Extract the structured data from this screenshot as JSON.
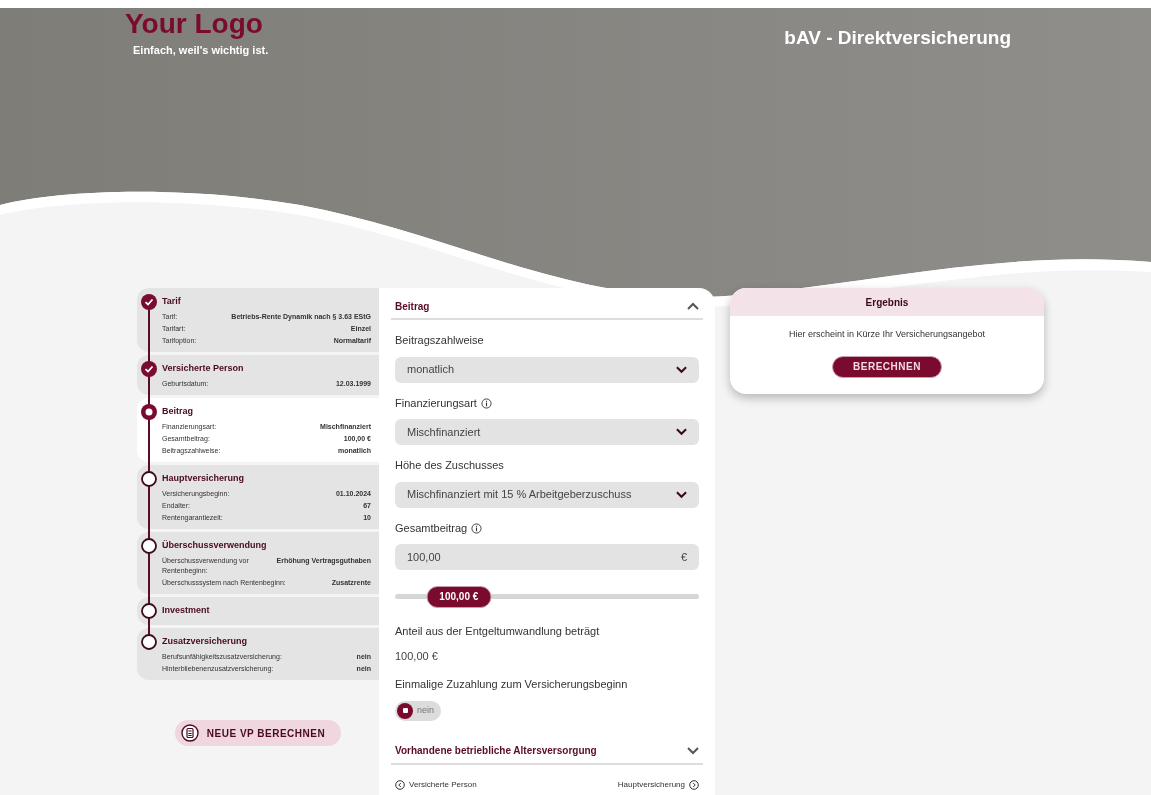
{
  "header": {
    "logo": "Your Logo",
    "tagline": "Einfach, weil's wichtig ist.",
    "title": "bAV - Direktversicherung"
  },
  "steps": [
    {
      "title": "Tarif",
      "done": true,
      "selected": false,
      "rows": [
        {
          "label": "Tarif:",
          "value": "Betriebs-Rente Dynamik nach § 3.63 EStG"
        },
        {
          "label": "Tarifart:",
          "value": "Einzel"
        },
        {
          "label": "Tarifoption:",
          "value": "Normaltarif"
        }
      ]
    },
    {
      "title": "Versicherte Person",
      "done": true,
      "selected": false,
      "rows": [
        {
          "label": "Geburtsdatum:",
          "value": "12.03.1999"
        }
      ]
    },
    {
      "title": "Beitrag",
      "done": false,
      "selected": true,
      "rows": [
        {
          "label": "Finanzierungsart:",
          "value": "Mischfinanziert"
        },
        {
          "label": "Gesamtbeitrag:",
          "value": "100,00 €"
        },
        {
          "label": "Beitragszahlweise:",
          "value": "monatlich"
        }
      ]
    },
    {
      "title": "Hauptversicherung",
      "done": false,
      "selected": false,
      "rows": [
        {
          "label": "Versicherungsbeginn:",
          "value": "01.10.2024"
        },
        {
          "label": "Endalter:",
          "value": "67"
        },
        {
          "label": "Rentengarantiezeit:",
          "value": "10"
        }
      ]
    },
    {
      "title": "Überschussverwendung",
      "done": false,
      "selected": false,
      "rows": [
        {
          "label": "Überschussverwendung vor Rentenbeginn:",
          "value": "Erhöhung Vertragsguthaben"
        },
        {
          "label": "Überschusssystem nach Rentenbeginn:",
          "value": "Zusatzrente"
        }
      ]
    },
    {
      "title": "Investment",
      "done": false,
      "selected": false
    },
    {
      "title": "Zusatzversicherung",
      "done": false,
      "selected": false,
      "rows": [
        {
          "label": "Berufsunfähigkeitszusatzversicherung:",
          "value": "nein"
        },
        {
          "label": "Hinterbliebenenzusatzversicherung:",
          "value": "nein"
        }
      ]
    }
  ],
  "new_button": "NEUE VP BERECHNEN",
  "form": {
    "section": "Beitrag",
    "expanded": true,
    "fields": [
      {
        "kind": "select",
        "label": "Beitragszahlweise",
        "info": false,
        "value": "monatlich"
      },
      {
        "kind": "select",
        "label": "Finanzierungsart",
        "info": true,
        "value": "Mischfinanziert"
      },
      {
        "kind": "select",
        "label": "Höhe des Zuschusses",
        "info": false,
        "value": "Mischfinanziert mit 15 % Arbeitgeberzuschuss"
      },
      {
        "kind": "amount",
        "label": "Gesamtbeitrag",
        "info": true,
        "value": "100,00",
        "unit": "€"
      },
      {
        "kind": "slider",
        "level": 0.21,
        "reading": "100,00 €"
      },
      {
        "kind": "text",
        "label": "Anteil aus der Entgeltumwandlung beträgt",
        "value": "100,00 €"
      },
      {
        "kind": "toggle",
        "label": "Einmalige Zuzahlung zum Versicherungsbeginn",
        "on": false,
        "value": "nein"
      }
    ],
    "next_section": {
      "title": "Vorhandene betriebliche Altersversorgung",
      "expanded": false
    },
    "back": "Versicherte Person",
    "forward": "Hauptversicherung"
  },
  "result": {
    "title": "Ergebnis",
    "message": "Hier erscheint in Kürze Ihr Versicherungsangebot",
    "button": "BERECHNEN"
  }
}
